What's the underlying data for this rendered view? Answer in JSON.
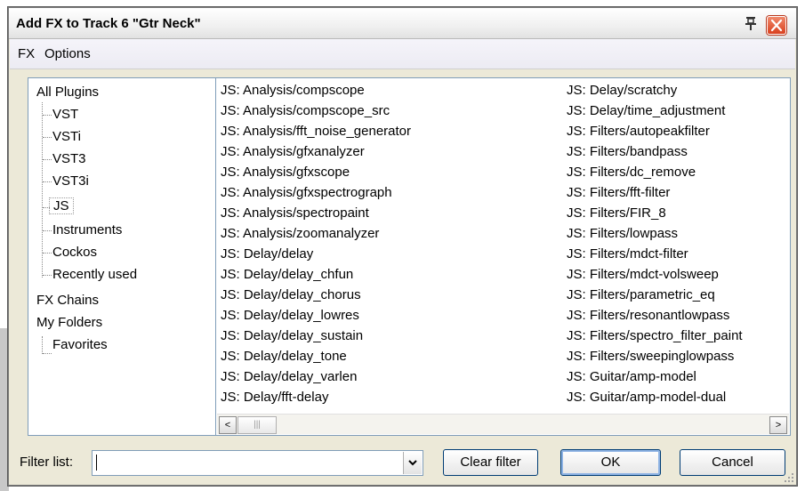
{
  "window": {
    "title": "Add FX to Track 6 \"Gtr Neck\""
  },
  "menu": {
    "items": [
      "FX",
      "Options"
    ]
  },
  "tree": {
    "items": [
      "All Plugins",
      "VST",
      "VSTi",
      "VST3",
      "VST3i",
      "JS",
      "Instruments",
      "Cockos",
      "Recently used",
      "FX Chains",
      "My Folders",
      "Favorites"
    ],
    "selected": "JS"
  },
  "plugins": {
    "column1": [
      "JS: Analysis/compscope",
      "JS: Analysis/compscope_src",
      "JS: Analysis/fft_noise_generator",
      "JS: Analysis/gfxanalyzer",
      "JS: Analysis/gfxscope",
      "JS: Analysis/gfxspectrograph",
      "JS: Analysis/spectropaint",
      "JS: Analysis/zoomanalyzer",
      "JS: Delay/delay",
      "JS: Delay/delay_chfun",
      "JS: Delay/delay_chorus",
      "JS: Delay/delay_lowres",
      "JS: Delay/delay_sustain",
      "JS: Delay/delay_tone",
      "JS: Delay/delay_varlen",
      "JS: Delay/fft-delay"
    ],
    "column2": [
      "JS: Delay/scratchy",
      "JS: Delay/time_adjustment",
      "JS: Filters/autopeakfilter",
      "JS: Filters/bandpass",
      "JS: Filters/dc_remove",
      "JS: Filters/fft-filter",
      "JS: Filters/FIR_8",
      "JS: Filters/lowpass",
      "JS: Filters/mdct-filter",
      "JS: Filters/mdct-volsweep",
      "JS: Filters/parametric_eq",
      "JS: Filters/resonantlowpass",
      "JS: Filters/spectro_filter_paint",
      "JS: Filters/sweepinglowpass",
      "JS: Guitar/amp-model",
      "JS: Guitar/amp-model-dual"
    ]
  },
  "scrollbar": {
    "left_arrow": "<",
    "right_arrow": ">",
    "thumb_grip": "|||"
  },
  "bottom": {
    "filter_label": "Filter list:",
    "filter_value": "",
    "dropdown_arrow": "⌄",
    "clear_label": "Clear filter",
    "ok_label": "OK",
    "cancel_label": "Cancel"
  },
  "icons": {
    "pin": "pin-icon",
    "close": "close-icon"
  },
  "colors": {
    "close_button": "#d9401e",
    "selection_border": "#003c74"
  }
}
